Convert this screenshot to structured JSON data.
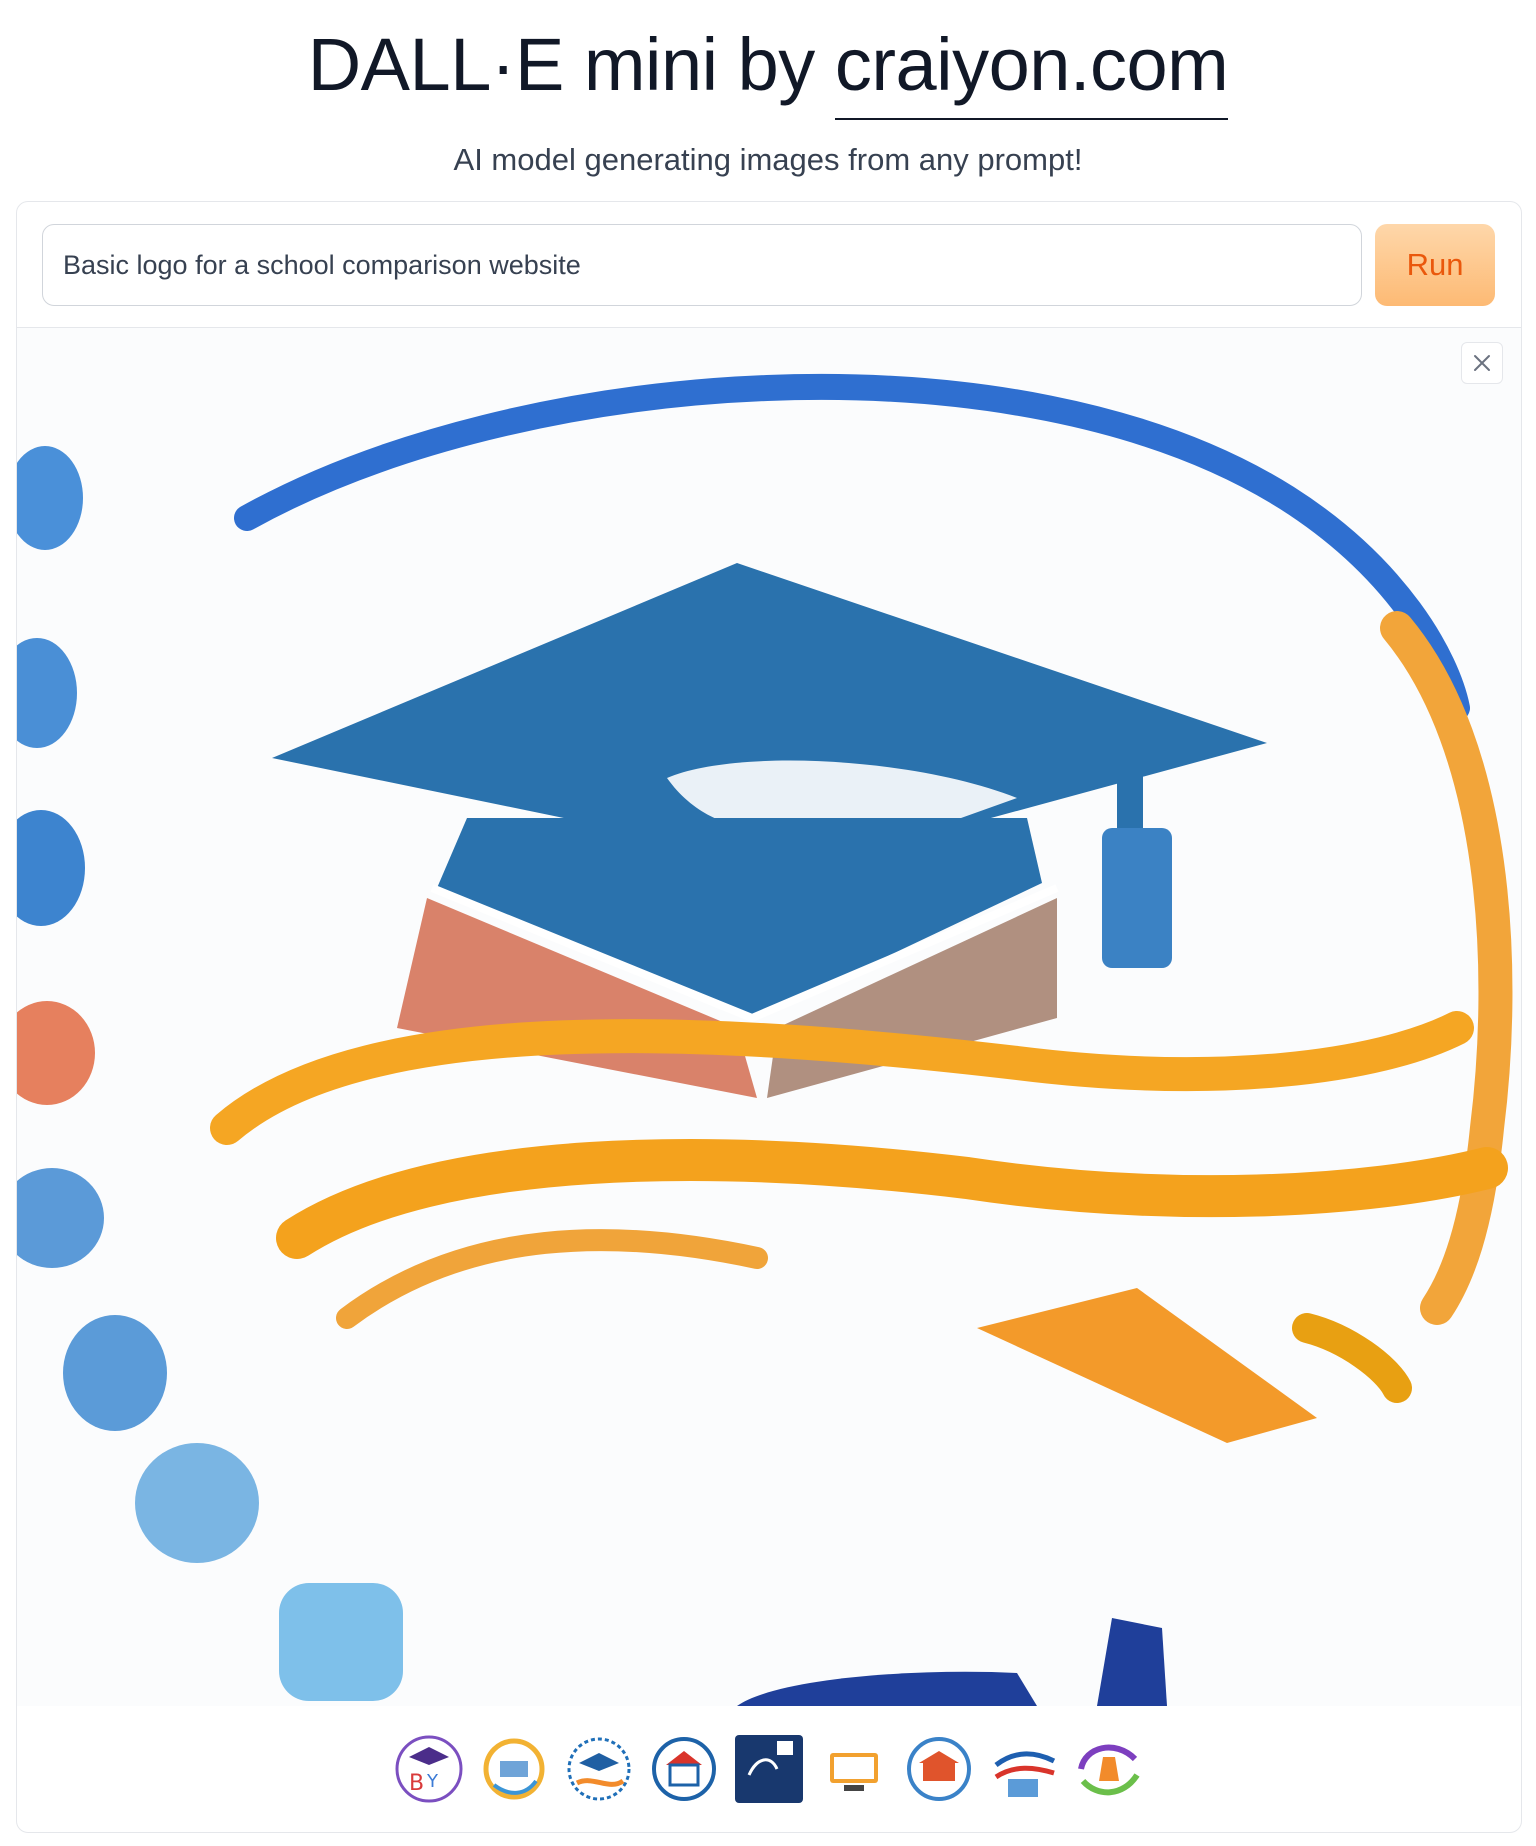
{
  "header": {
    "title_prefix": "DALL·E mini by ",
    "title_link": "craiyon.com",
    "subtitle": "AI model generating images from any prompt!"
  },
  "prompt": {
    "value": "Basic logo for a school comparison website",
    "placeholder": ""
  },
  "run_label": "Run",
  "icons": {
    "close": "close-icon"
  },
  "thumbnails": [
    {
      "name": "thumbnail-1"
    },
    {
      "name": "thumbnail-2"
    },
    {
      "name": "thumbnail-3"
    },
    {
      "name": "thumbnail-4"
    },
    {
      "name": "thumbnail-5"
    },
    {
      "name": "thumbnail-6"
    },
    {
      "name": "thumbnail-7"
    },
    {
      "name": "thumbnail-8"
    },
    {
      "name": "thumbnail-9"
    }
  ],
  "colors": {
    "run_button_bg": "#fdba74",
    "run_button_text": "#ea580c",
    "cap_blue": "#2a6ea8",
    "ribbon_orange": "#f5a623"
  }
}
